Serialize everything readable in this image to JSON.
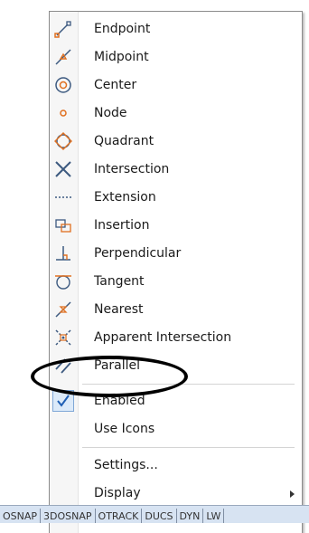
{
  "menu": {
    "items": [
      {
        "label": "Endpoint",
        "icon": "endpoint-icon"
      },
      {
        "label": "Midpoint",
        "icon": "midpoint-icon"
      },
      {
        "label": "Center",
        "icon": "center-icon"
      },
      {
        "label": "Node",
        "icon": "node-icon"
      },
      {
        "label": "Quadrant",
        "icon": "quadrant-icon"
      },
      {
        "label": "Intersection",
        "icon": "intersection-icon"
      },
      {
        "label": "Extension",
        "icon": "extension-icon"
      },
      {
        "label": "Insertion",
        "icon": "insertion-icon"
      },
      {
        "label": "Perpendicular",
        "icon": "perpendicular-icon"
      },
      {
        "label": "Tangent",
        "icon": "tangent-icon"
      },
      {
        "label": "Nearest",
        "icon": "nearest-icon"
      },
      {
        "label": "Apparent Intersection",
        "icon": "apparent-intersection-icon"
      },
      {
        "label": "Parallel",
        "icon": "parallel-icon"
      }
    ],
    "enabled_label": "Enabled",
    "enabled_checked": true,
    "use_icons_label": "Use Icons",
    "settings_label": "Settings...",
    "display_label": "Display"
  },
  "highlighted_item": "Perpendicular",
  "statusbar": {
    "buttons": [
      "OSNAP",
      "3DOSNAP",
      "OTRACK",
      "DUCS",
      "DYN",
      "LW"
    ]
  },
  "colors": {
    "icon_color": "#3d5a80",
    "accent_orange": "#e07020",
    "check_color": "#1f5fb4",
    "status_bg": "#d7e3f2"
  }
}
